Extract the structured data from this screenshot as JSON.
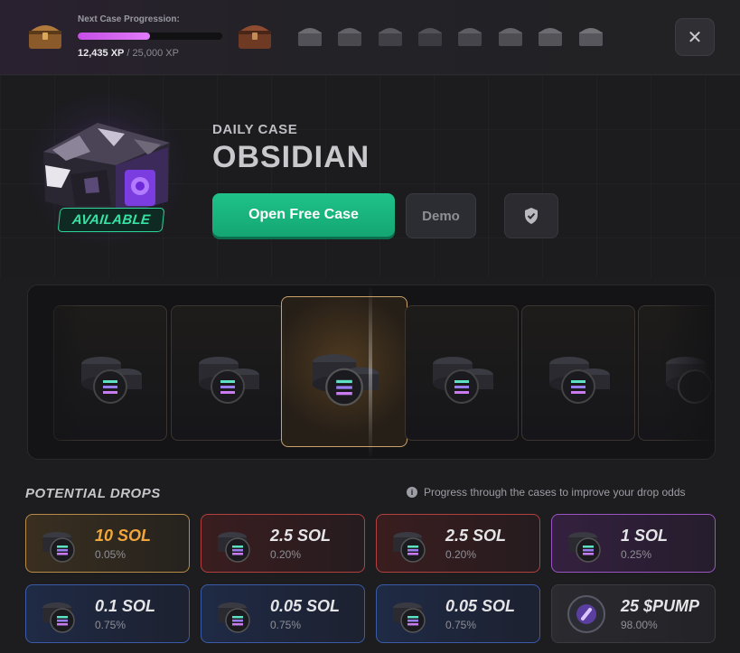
{
  "progression": {
    "label": "Next Case Progression:",
    "xp_current": "12,435 XP",
    "xp_separator": " / ",
    "xp_max": "25,000 XP",
    "progress_fraction": 0.497
  },
  "close_icon": "close-icon",
  "hero": {
    "subtitle": "DAILY CASE",
    "title": "OBSIDIAN",
    "badge": "AVAILABLE",
    "open_button": "Open Free Case",
    "demo_button": "Demo",
    "fair_icon": "shield-check-icon"
  },
  "drops": {
    "title": "POTENTIAL DROPS",
    "note": "Progress through the cases to improve your drop odds",
    "items": [
      {
        "name": "10 SOL",
        "pct": "0.05%",
        "tier": "gold"
      },
      {
        "name": "2.5 SOL",
        "pct": "0.20%",
        "tier": "red"
      },
      {
        "name": "2.5 SOL",
        "pct": "0.20%",
        "tier": "red"
      },
      {
        "name": "1 SOL",
        "pct": "0.25%",
        "tier": "purple"
      },
      {
        "name": "0.1 SOL",
        "pct": "0.75%",
        "tier": "blue"
      },
      {
        "name": "0.05 SOL",
        "pct": "0.75%",
        "tier": "blue"
      },
      {
        "name": "0.05 SOL",
        "pct": "0.75%",
        "tier": "blue"
      },
      {
        "name": "25 $PUMP",
        "pct": "98.00%",
        "tier": "grey"
      }
    ]
  },
  "colors": {
    "accent_green": "#1fc28a",
    "progress_purple": "#c64ee6",
    "gold": "#f0a63a"
  }
}
